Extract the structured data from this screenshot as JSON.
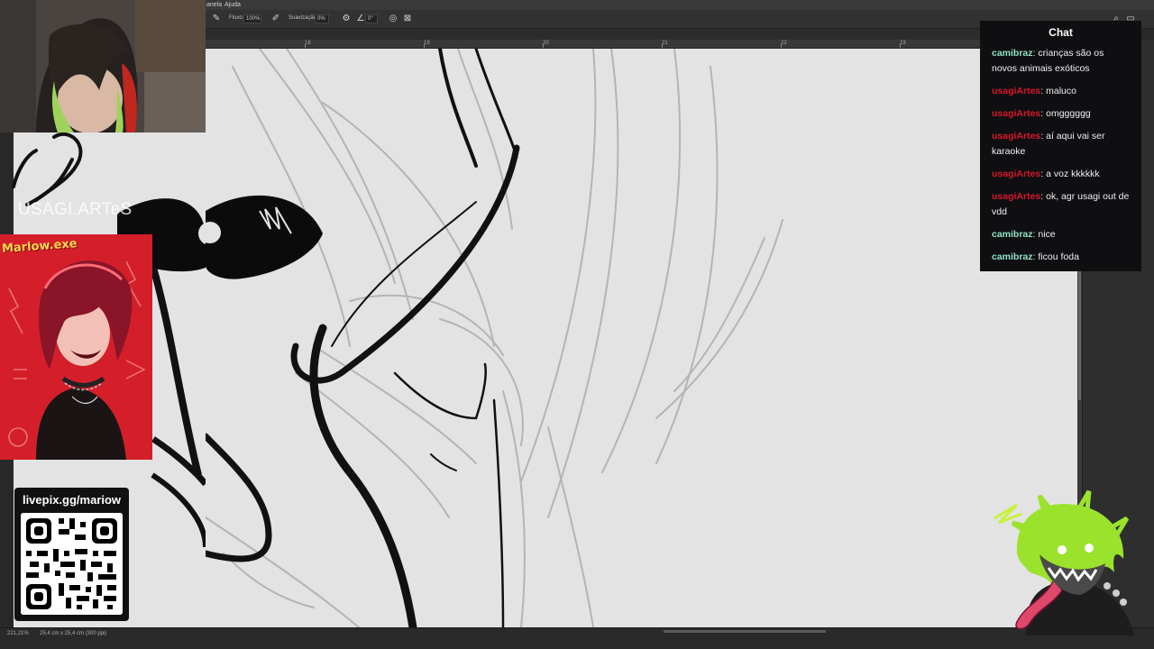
{
  "app": {
    "menu": [
      "anela",
      "Ajuda"
    ],
    "options": {
      "flow_label": "Fluxo:",
      "flow_value": "100%",
      "smoothing_label": "Suavização:",
      "smoothing_value": "0%",
      "angle_value": "0°"
    },
    "ruler_ticks": [
      "18",
      "19",
      "20",
      "21",
      "22",
      "23"
    ],
    "status": {
      "zoom": "221,21%",
      "doc_size": "25,4 cm x 25,4 cm (300 ppi)"
    }
  },
  "overlay": {
    "watermark": "USAGI.ARTeS",
    "art_title": "Marlow.exe",
    "qr_label": "livepix.gg/mariow"
  },
  "chat": {
    "title": "Chat",
    "messages": [
      {
        "user": "camibraz",
        "text": "crianças são os novos animais exóticos",
        "color": "#8fe0c4"
      },
      {
        "user": "usagiArtes",
        "text": "maluco",
        "color": "#d9162b"
      },
      {
        "user": "usagiArtes",
        "text": "omgggggg",
        "color": "#d9162b"
      },
      {
        "user": "usagiArtes",
        "text": "aí aqui vai ser karaoke",
        "color": "#d9162b"
      },
      {
        "user": "usagiArtes",
        "text": "a voz kkkkkk",
        "color": "#d9162b"
      },
      {
        "user": "usagiArtes",
        "text": "ok, agr usagi out de vdd",
        "color": "#d9162b"
      },
      {
        "user": "camibraz",
        "text": "nice",
        "color": "#8fe0c4"
      },
      {
        "user": "camibraz",
        "text": "ficou foda",
        "color": "#8fe0c4"
      }
    ]
  },
  "colors": {
    "canvas": "#e3e3e3",
    "chat_bg": "#0f0f12",
    "accent_red": "#d41f2a",
    "mascot_green": "#9be22d"
  }
}
